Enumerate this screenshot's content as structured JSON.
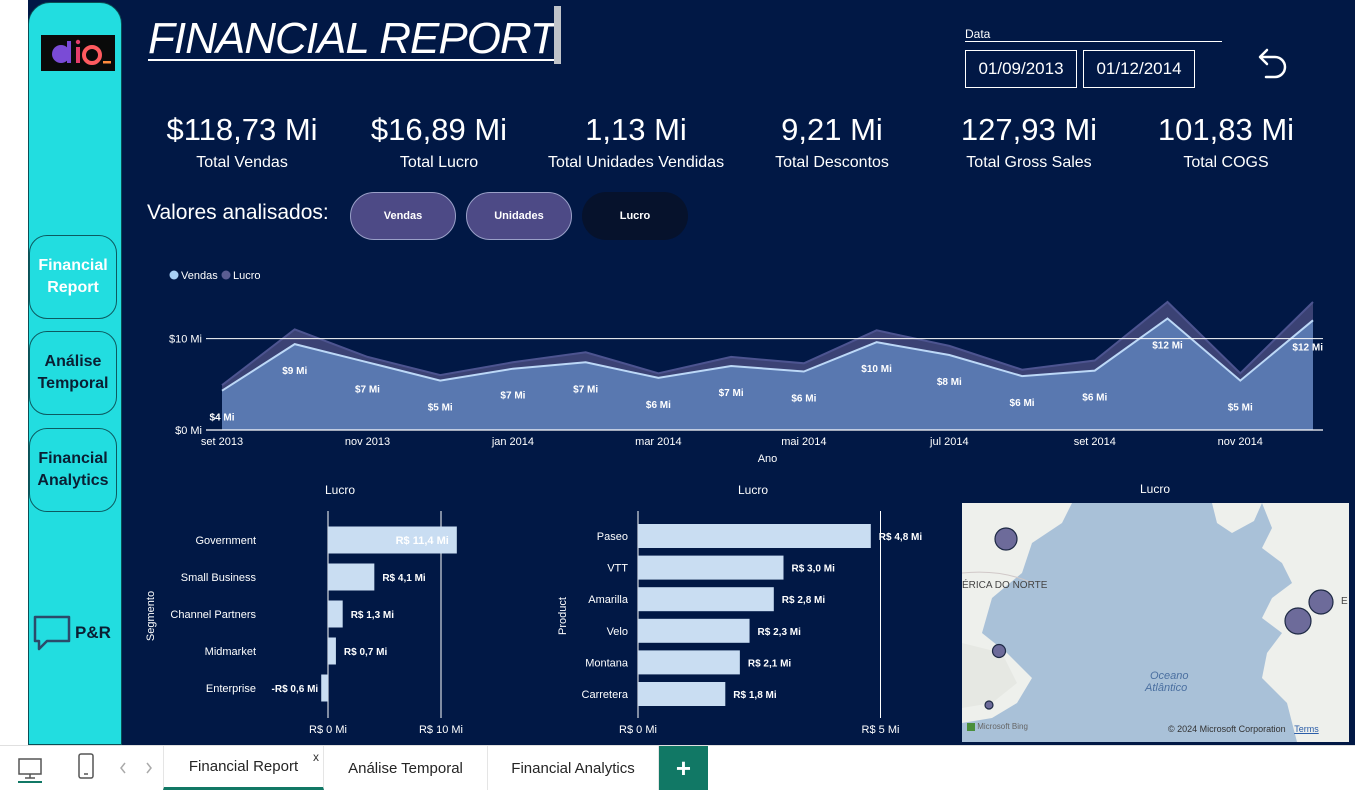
{
  "title": "FINANCIAL REPORT",
  "date_filter": {
    "label": "Data",
    "start": "01/09/2013",
    "end": "01/12/2014"
  },
  "kpis": [
    {
      "value": "$118,73 Mi",
      "label": "Total Vendas"
    },
    {
      "value": "$16,89 Mi",
      "label": "Total Lucro"
    },
    {
      "value": "1,13 Mi",
      "label": "Total Unidades Vendidas"
    },
    {
      "value": "9,21 Mi",
      "label": "Total Descontos"
    },
    {
      "value": "127,93 Mi",
      "label": "Total Gross Sales"
    },
    {
      "value": "101,83 Mi",
      "label": "Total COGS"
    }
  ],
  "analyzed": {
    "label": "Valores analisados:",
    "buttons": [
      "Vendas",
      "Unidades",
      "Lucro"
    ],
    "selected": "Lucro"
  },
  "sidebar": {
    "nav": [
      "Financial Report",
      "Análise Temporal",
      "Financial Analytics"
    ],
    "active": "Financial Report",
    "pr_label": "P&R"
  },
  "colors": {
    "background": "#011845",
    "sidebar": "#22dde0",
    "accent": "#117865",
    "area_light": "#5b7bb3",
    "area_dark": "#3e4577",
    "bar": "#c9ddf2"
  },
  "chart_data": [
    {
      "type": "area",
      "legend": [
        "Vendas",
        "Lucro"
      ],
      "legend_position": "top-left",
      "xlabel": "Ano",
      "x_ticks": [
        "set 2013",
        "nov 2013",
        "jan 2014",
        "mar 2014",
        "mai 2014",
        "jul 2014",
        "set 2014",
        "nov 2014"
      ],
      "y_ticks": [
        "$0 Mi",
        "$10 Mi"
      ],
      "ylim": [
        0,
        14
      ],
      "x": [
        "set 2013",
        "out 2013",
        "nov 2013",
        "dez 2013",
        "jan 2014",
        "fev 2014",
        "mar 2014",
        "abr 2014",
        "mai 2014",
        "jun 2014",
        "jul 2014",
        "ago 2014",
        "set 2014",
        "out 2014",
        "nov 2014",
        "dez 2014"
      ],
      "series": [
        {
          "name": "Vendas",
          "values": [
            4.3,
            9.4,
            7.4,
            5.4,
            6.7,
            7.4,
            5.7,
            7.0,
            6.4,
            9.6,
            8.2,
            5.9,
            6.5,
            12.2,
            5.4,
            12.0
          ]
        },
        {
          "name": "Lucro",
          "values": [
            4.9,
            11.0,
            8.0,
            6.0,
            7.4,
            8.5,
            6.2,
            8.0,
            7.3,
            10.9,
            9.2,
            6.6,
            7.6,
            14.0,
            6.2,
            14.0
          ]
        }
      ],
      "data_labels": [
        "$4 Mi",
        "$9 Mi",
        "$7 Mi",
        "$5 Mi",
        "$7 Mi",
        "$7 Mi",
        "$6 Mi",
        "$7 Mi",
        "$6 Mi",
        "$10 Mi",
        "$8 Mi",
        "$6 Mi",
        "$6 Mi",
        "$12 Mi",
        "$5 Mi",
        "$12 Mi"
      ],
      "grid": false
    },
    {
      "type": "bar",
      "orientation": "horizontal",
      "title": "Lucro",
      "ylabel": "Segmento",
      "categories": [
        "Government",
        "Small Business",
        "Channel Partners",
        "Midmarket",
        "Enterprise"
      ],
      "values": [
        11.4,
        4.1,
        1.3,
        0.7,
        -0.6
      ],
      "data_labels": [
        "R$ 11,4 Mi",
        "R$ 4,1 Mi",
        "R$ 1,3 Mi",
        "R$ 0,7 Mi",
        "-R$ 0,6 Mi"
      ],
      "x_ticks": [
        "R$ 0 Mi",
        "R$ 10 Mi"
      ]
    },
    {
      "type": "bar",
      "orientation": "horizontal",
      "title": "Lucro",
      "ylabel": "Product",
      "categories": [
        "Paseo",
        "VTT",
        "Amarilla",
        "Velo",
        "Montana",
        "Carretera"
      ],
      "values": [
        4.8,
        3.0,
        2.8,
        2.3,
        2.1,
        1.8
      ],
      "data_labels": [
        "R$ 4,8 Mi",
        "R$ 3,0 Mi",
        "R$ 2,8 Mi",
        "R$ 2,3 Mi",
        "R$ 2,1 Mi",
        "R$ 1,8 Mi"
      ],
      "x_ticks": [
        "R$ 0 Mi",
        "R$ 5 Mi"
      ]
    }
  ],
  "map": {
    "title": "Lucro",
    "labels": [
      "ÉRICA DO NORTE",
      "Oceano",
      "Atlântico",
      "E"
    ],
    "attribution": "© 2024 Microsoft Corporation",
    "terms": "Terms",
    "provider": "Microsoft Bing"
  },
  "tabs": [
    "Financial Report",
    "Análise Temporal",
    "Financial Analytics"
  ],
  "active_tab": "Financial Report",
  "tab_close": "x",
  "add_tab": "+"
}
